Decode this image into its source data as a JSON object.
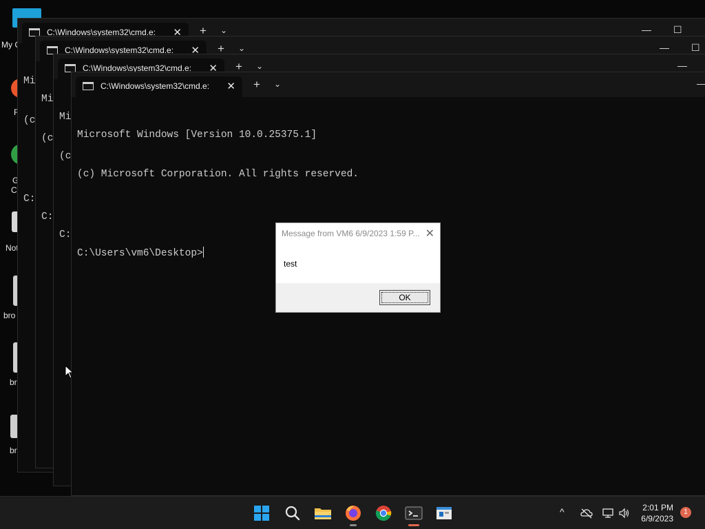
{
  "desktop": {
    "icons": [
      {
        "label": "My C",
        "icon": "this-pc-icon"
      },
      {
        "label": "F",
        "icon": "firefox-icon"
      },
      {
        "label": "G",
        "icon": "chrome-icon"
      },
      {
        "label": "C",
        "icon": "chrome-icon"
      },
      {
        "label": "Not",
        "icon": "notepad-icon"
      },
      {
        "label": "bro",
        "icon": "file-icon"
      },
      {
        "label": "br",
        "icon": "file-icon"
      },
      {
        "label": "bro wri",
        "icon": "file-icon"
      }
    ]
  },
  "terminals": [
    {
      "tab_title": "C:\\Windows\\system32\\cmd.e:",
      "lines": [
        "Mi",
        "(c",
        "",
        "C:"
      ]
    },
    {
      "tab_title": "C:\\Windows\\system32\\cmd.e:",
      "lines": [
        "Mi",
        "(c",
        "",
        "C:"
      ]
    },
    {
      "tab_title": "C:\\Windows\\system32\\cmd.e:",
      "lines": [
        "Mi",
        "(c",
        "",
        "C:"
      ]
    },
    {
      "tab_title": "C:\\Windows\\system32\\cmd.e:",
      "lines": [
        "Microsoft Windows [Version 10.0.25375.1]",
        "(c) Microsoft Corporation. All rights reserved.",
        ""
      ],
      "prompt": "C:\\Users\\vm6\\Desktop>"
    }
  ],
  "glyphs": {
    "close": "✕",
    "plus": "+",
    "chevron": "⌄",
    "minimize": "—",
    "maximize": "☐"
  },
  "dialog": {
    "title": "Message from VM6 6/9/2023 1:59 P...",
    "message": "test",
    "ok_label": "OK"
  },
  "taskbar": {
    "apps": [
      {
        "name": "start-button",
        "icon": "windows-logo-icon"
      },
      {
        "name": "search-button",
        "icon": "search-icon"
      },
      {
        "name": "file-explorer",
        "icon": "folder-icon"
      },
      {
        "name": "firefox",
        "icon": "firefox-icon"
      },
      {
        "name": "chrome",
        "icon": "chrome-icon"
      },
      {
        "name": "terminal",
        "icon": "terminal-icon"
      },
      {
        "name": "remote-app",
        "icon": "window-icon"
      }
    ],
    "tray": {
      "chevron": "^"
    },
    "clock": {
      "time": "2:01 PM",
      "date": "6/9/2023"
    },
    "notification_count": "1"
  },
  "colors": {
    "accent": "#e0674f",
    "terminal_bg": "#0c0c0c",
    "taskbar_bg": "#1c1c1c"
  }
}
